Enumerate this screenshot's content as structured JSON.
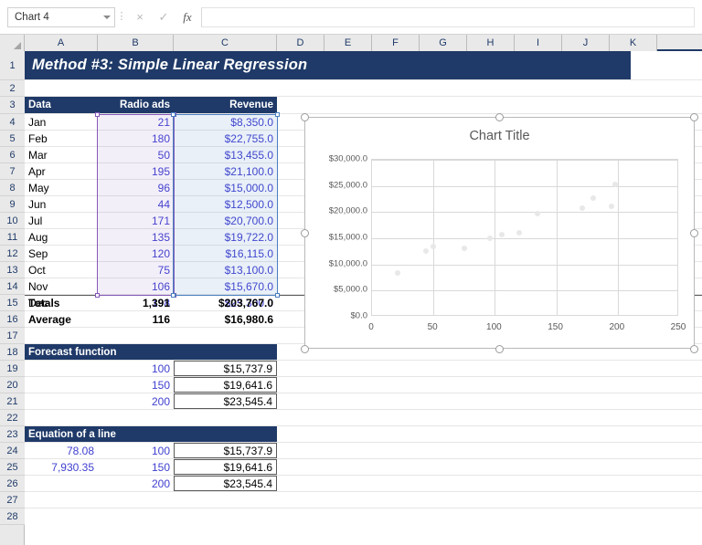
{
  "formula_bar": {
    "name_box_value": "Chart 4",
    "formula_value": "",
    "cancel_icon": "×",
    "confirm_icon": "✓",
    "function_icon": "fx"
  },
  "grid": {
    "column_headers": [
      "A",
      "B",
      "C",
      "D",
      "E",
      "F",
      "G",
      "H",
      "I",
      "J",
      "K"
    ],
    "row_numbers": [
      "1",
      "2",
      "3",
      "4",
      "5",
      "6",
      "7",
      "8",
      "9",
      "10",
      "11",
      "12",
      "13",
      "14",
      "15",
      "16",
      "17",
      "18",
      "19",
      "20",
      "21",
      "22",
      "23",
      "24",
      "25",
      "26",
      "27",
      "28"
    ]
  },
  "title_banner": {
    "text": "Method #3: Simple Linear Regression"
  },
  "data_table": {
    "headers": {
      "a": "Data",
      "b": "Radio ads",
      "c": "Revenue"
    },
    "rows": [
      {
        "month": "Jan",
        "ads": "21",
        "revenue": "$8,350.0"
      },
      {
        "month": "Feb",
        "ads": "180",
        "revenue": "$22,755.0"
      },
      {
        "month": "Mar",
        "ads": "50",
        "revenue": "$13,455.0"
      },
      {
        "month": "Apr",
        "ads": "195",
        "revenue": "$21,100.0"
      },
      {
        "month": "May",
        "ads": "96",
        "revenue": "$15,000.0"
      },
      {
        "month": "Jun",
        "ads": "44",
        "revenue": "$12,500.0"
      },
      {
        "month": "Jul",
        "ads": "171",
        "revenue": "$20,700.0"
      },
      {
        "month": "Aug",
        "ads": "135",
        "revenue": "$19,722.0"
      },
      {
        "month": "Sep",
        "ads": "120",
        "revenue": "$16,115.0"
      },
      {
        "month": "Oct",
        "ads": "75",
        "revenue": "$13,100.0"
      },
      {
        "month": "Nov",
        "ads": "106",
        "revenue": "$15,670.0"
      },
      {
        "month": "Dec",
        "ads": "198",
        "revenue": "$25,300.0"
      }
    ],
    "totals": {
      "label": "Totals",
      "ads": "1,391",
      "revenue": "$203,767.0"
    },
    "average": {
      "label": "Average",
      "ads": "116",
      "revenue": "$16,980.6"
    }
  },
  "forecast_function": {
    "header": "Forecast function",
    "rows": [
      {
        "x": "100",
        "y": "$15,737.9"
      },
      {
        "x": "150",
        "y": "$19,641.6"
      },
      {
        "x": "200",
        "y": "$23,545.4"
      }
    ]
  },
  "equation_of_a_line": {
    "header": "Equation of a line",
    "slope": "78.08",
    "intercept": "7,930.35",
    "rows": [
      {
        "x": "100",
        "y": "$15,737.9"
      },
      {
        "x": "150",
        "y": "$19,641.6"
      },
      {
        "x": "200",
        "y": "$23,545.4"
      }
    ]
  },
  "chart_data": {
    "type": "scatter",
    "title": "Chart Title",
    "xlabel": "",
    "ylabel": "",
    "xlim": [
      0,
      250
    ],
    "ylim": [
      0,
      30000
    ],
    "xticks": [
      "0",
      "50",
      "100",
      "150",
      "200",
      "250"
    ],
    "xtick_values": [
      0,
      50,
      100,
      150,
      200,
      250
    ],
    "yticks": [
      "$0.0",
      "$5,000.0",
      "$10,000.0",
      "$15,000.0",
      "$20,000.0",
      "$25,000.0",
      "$30,000.0"
    ],
    "ytick_values": [
      0,
      5000,
      10000,
      15000,
      20000,
      25000,
      30000
    ],
    "grid": true,
    "legend": false,
    "marker_color": "#e8e8e8",
    "series": [
      {
        "name": "Revenue",
        "points": [
          {
            "x": 21,
            "y": 8350
          },
          {
            "x": 180,
            "y": 22755
          },
          {
            "x": 50,
            "y": 13455
          },
          {
            "x": 195,
            "y": 21100
          },
          {
            "x": 96,
            "y": 15000
          },
          {
            "x": 44,
            "y": 12500
          },
          {
            "x": 171,
            "y": 20700
          },
          {
            "x": 135,
            "y": 19722
          },
          {
            "x": 120,
            "y": 16115
          },
          {
            "x": 75,
            "y": 13100
          },
          {
            "x": 106,
            "y": 15670
          },
          {
            "x": 198,
            "y": 25300
          }
        ]
      }
    ]
  },
  "selection": {
    "range_b_color": "#8558b8",
    "range_c_color": "#4a7fc1"
  }
}
